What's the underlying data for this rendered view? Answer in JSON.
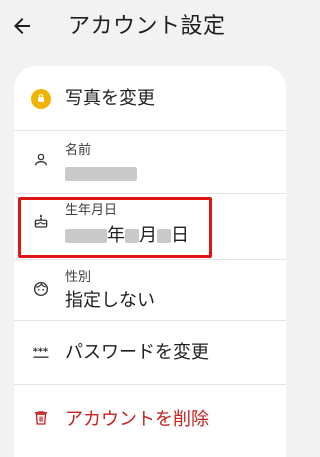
{
  "header": {
    "title": "アカウント設定",
    "back_icon": "arrow-left-icon"
  },
  "rows": {
    "photo": {
      "label": "写真を変更",
      "icon": "avatar-lock-icon",
      "icon_color": "#f0b400"
    },
    "name": {
      "caption": "名前",
      "value": "",
      "icon": "person-icon"
    },
    "birthday": {
      "caption": "生年月日",
      "year_suffix": "年",
      "month_suffix": "月",
      "day_suffix": "日",
      "icon": "cake-icon"
    },
    "gender": {
      "caption": "性別",
      "value": "指定しない",
      "icon": "face-icon"
    },
    "password": {
      "label": "パスワードを変更",
      "icon": "password-dots-icon"
    },
    "delete": {
      "label": "アカウントを削除",
      "icon": "trash-icon",
      "color": "#c5221f"
    }
  },
  "highlight_color": "#e01515"
}
